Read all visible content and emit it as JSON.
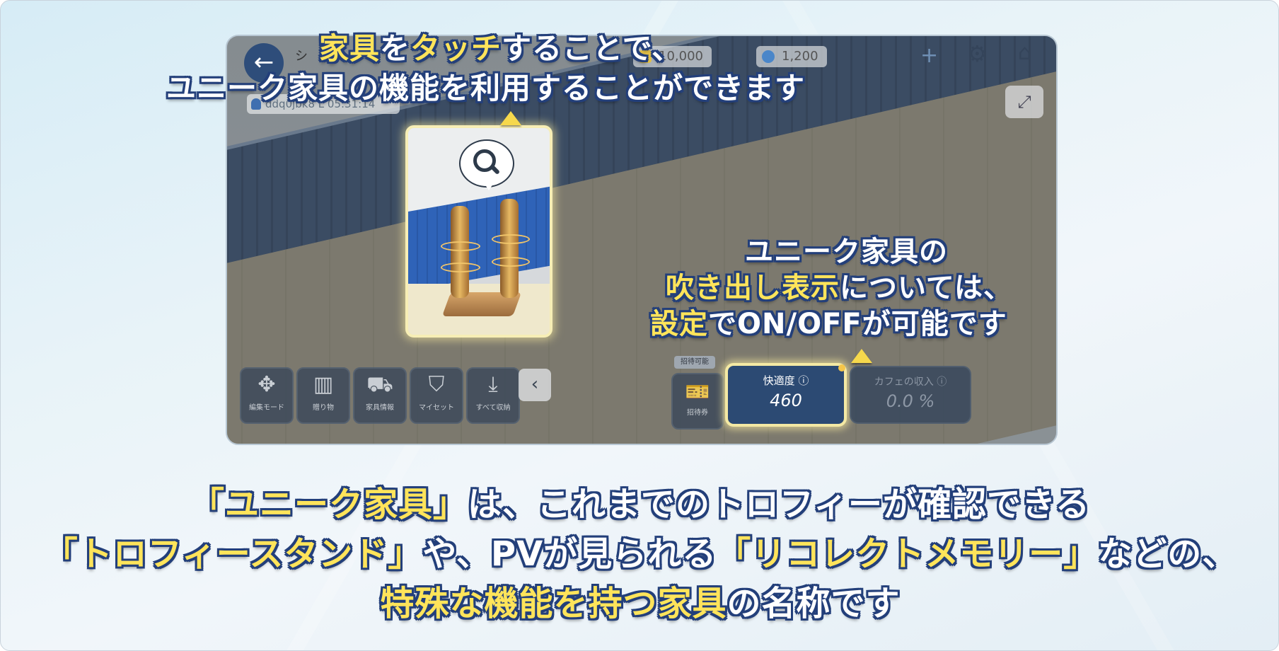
{
  "top_bar": {
    "back_icon": "arrow-left-icon",
    "title_fragment": "シ",
    "coins": "10,000",
    "gems": "1,200",
    "plus_label": "+"
  },
  "user_tag": "ddq0jbk8 L 05:31:14",
  "toolbar": [
    {
      "icon": "move-icon",
      "label": "編集モード"
    },
    {
      "icon": "gift-icon",
      "label": "贈り物"
    },
    {
      "icon": "cart-icon",
      "label": "家具情報"
    },
    {
      "icon": "bookmark-icon",
      "label": "マイセット"
    },
    {
      "icon": "download-icon",
      "label": "すべて収納"
    }
  ],
  "invite": {
    "tag": "招待可能",
    "label": "招待券"
  },
  "comfort": {
    "label": "快適度 ⓘ",
    "value": "460"
  },
  "income": {
    "label": "カフェの収入 ⓘ",
    "value": "0.0 %"
  },
  "callouts": {
    "top_line1_a": "家具",
    "top_line1_b": "を",
    "top_line1_c": "タッチ",
    "top_line1_d": "することで、",
    "top_line2": "ユニーク家具の機能を利用することができます",
    "right_line1": "ユニーク家具の",
    "right_line2_hl": "吹き出し表示",
    "right_line2_rest": "については、",
    "right_line3_hl": "設定",
    "right_line3_rest": "でON/OFFが可能です"
  },
  "bottom_text": {
    "l1_hl": "「ユニーク家具」",
    "l1_rest": "は、これまでのトロフィーが確認できる",
    "l2_hl1": "「トロフィースタンド」",
    "l2_mid": "や、PVが見られる",
    "l2_hl2": "「リコレクトメモリー」",
    "l2_rest": "などの、",
    "l3_hl": "特殊な機能を持つ家具",
    "l3_rest": "の名称です"
  },
  "colors": {
    "highlight": "#ffe45a",
    "outline": "#233f7a",
    "accent": "#2c4a73"
  }
}
